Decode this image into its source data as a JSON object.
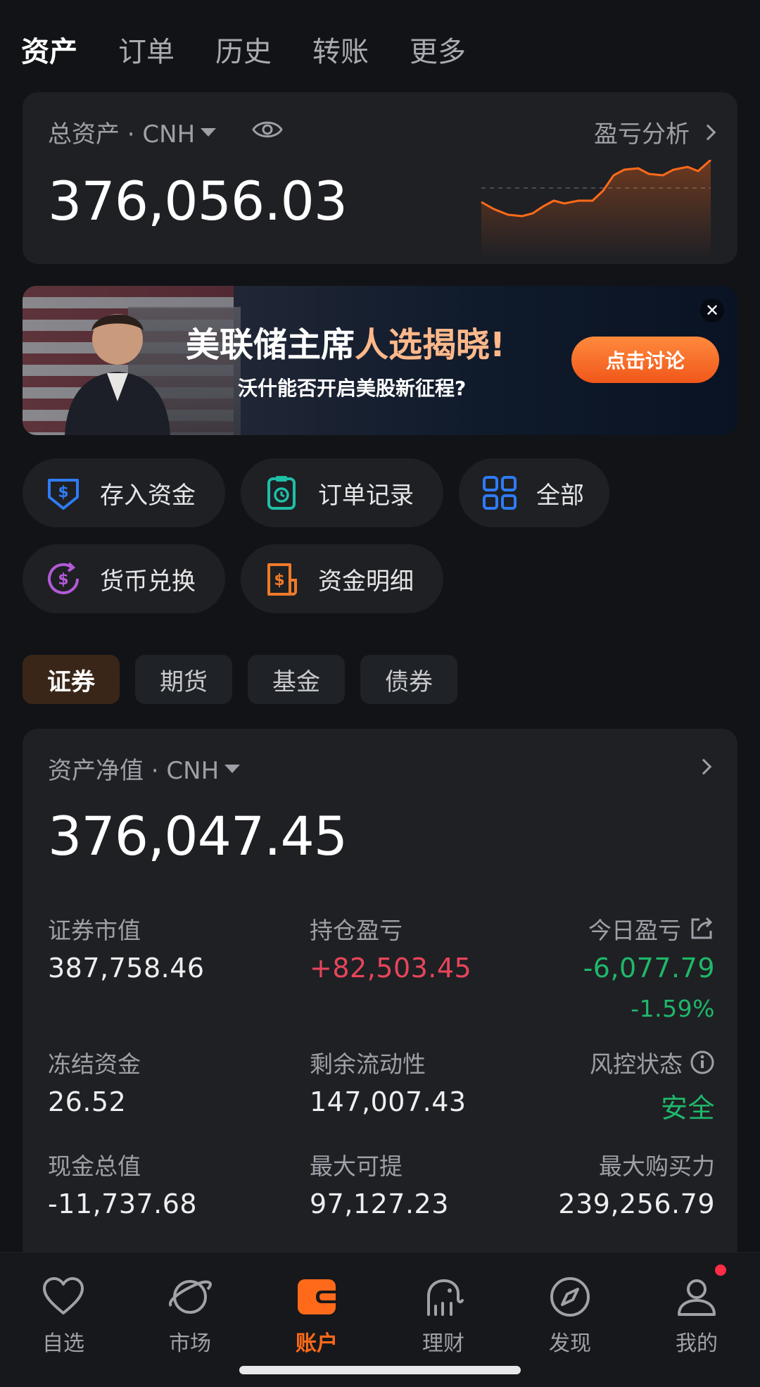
{
  "top_tabs": [
    "资产",
    "订单",
    "历史",
    "转账",
    "更多"
  ],
  "asset_card": {
    "label": "总资产 · CNH",
    "value": "376,056.03",
    "pnl_link": "盈亏分析"
  },
  "banner": {
    "title_main": "美联储主席",
    "title_highlight": "人选揭晓!",
    "subtitle": "沃什能否开启美股新征程?",
    "cta": "点击讨论",
    "close": "✕"
  },
  "actions": [
    {
      "label": "存入资金",
      "icon": "deposit-icon"
    },
    {
      "label": "订单记录",
      "icon": "order-record-icon"
    },
    {
      "label": "全部",
      "icon": "grid-icon"
    },
    {
      "label": "货币兑换",
      "icon": "currency-exchange-icon"
    },
    {
      "label": "资金明细",
      "icon": "fund-detail-icon"
    }
  ],
  "segments": [
    "证券",
    "期货",
    "基金",
    "债券"
  ],
  "net_card": {
    "label": "资产净值 · CNH",
    "value": "376,047.45",
    "stats": {
      "market_value_label": "证券市值",
      "market_value": "387,758.46",
      "position_pnl_label": "持仓盈亏",
      "position_pnl": "+82,503.45",
      "today_pnl_label": "今日盈亏",
      "today_pnl": "-6,077.79",
      "today_pnl_pct": "-1.59%",
      "frozen_label": "冻结资金",
      "frozen": "26.52",
      "liquidity_label": "剩余流动性",
      "liquidity": "147,007.43",
      "risk_label": "风控状态",
      "risk": "安全",
      "cash_label": "现金总值",
      "cash": "-11,737.68",
      "max_withdraw_label": "最大可提",
      "max_withdraw": "97,127.23",
      "max_buy_label": "最大购买力",
      "max_buy": "239,256.79"
    }
  },
  "bottom_nav": [
    {
      "label": "自选",
      "icon": "heart-icon"
    },
    {
      "label": "市场",
      "icon": "planet-icon"
    },
    {
      "label": "账户",
      "icon": "wallet-icon"
    },
    {
      "label": "理财",
      "icon": "elephant-icon"
    },
    {
      "label": "发现",
      "icon": "compass-icon"
    },
    {
      "label": "我的",
      "icon": "user-icon"
    }
  ],
  "colors": {
    "accent": "#ff6a1a",
    "up": "#e8455a",
    "down": "#1fb86a",
    "background": "#121316",
    "card": "#1f2024"
  }
}
